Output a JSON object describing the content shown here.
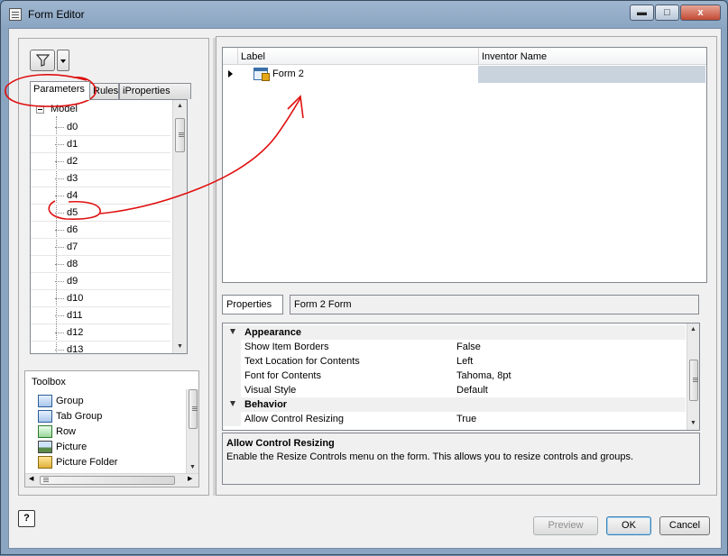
{
  "window": {
    "title": "Form Editor",
    "min_icon": "minimize-icon",
    "max_icon": "maximize-icon",
    "close_glyph": "x"
  },
  "left": {
    "tabs": [
      "Parameters",
      "Rules",
      "iProperties"
    ],
    "active_tab": "Parameters",
    "tree_root": "Model",
    "tree_items": [
      "d0",
      "d1",
      "d2",
      "d3",
      "d4",
      "d5",
      "d6",
      "d7",
      "d8",
      "d9",
      "d10",
      "d11",
      "d12",
      "d13"
    ],
    "toolbox_title": "Toolbox",
    "toolbox_items": [
      "Group",
      "Tab Group",
      "Row",
      "Picture",
      "Picture Folder"
    ]
  },
  "grid": {
    "columns": [
      "Label",
      "Inventor Name"
    ],
    "rows": [
      {
        "label": "Form 2",
        "inventor_name": ""
      }
    ]
  },
  "properties": {
    "label": "Properties",
    "object": "Form 2 Form",
    "categories": [
      {
        "name": "Appearance",
        "props": [
          {
            "name": "Show Item Borders",
            "value": "False"
          },
          {
            "name": "Text Location for Contents",
            "value": "Left"
          },
          {
            "name": "Font for Contents",
            "value": "Tahoma, 8pt"
          },
          {
            "name": "Visual Style",
            "value": "Default"
          }
        ]
      },
      {
        "name": "Behavior",
        "props": [
          {
            "name": "Allow Control Resizing",
            "value": "True"
          }
        ]
      }
    ],
    "description_title": "Allow Control Resizing",
    "description_text": "Enable the Resize Controls menu on the form.  This allows you to resize controls and groups."
  },
  "buttons": {
    "help": "?",
    "preview": "Preview",
    "ok": "OK",
    "cancel": "Cancel"
  },
  "colors": {
    "annotation": "#e01010",
    "selection": "#c9d3de",
    "title_bar": "#9fb6cf"
  }
}
